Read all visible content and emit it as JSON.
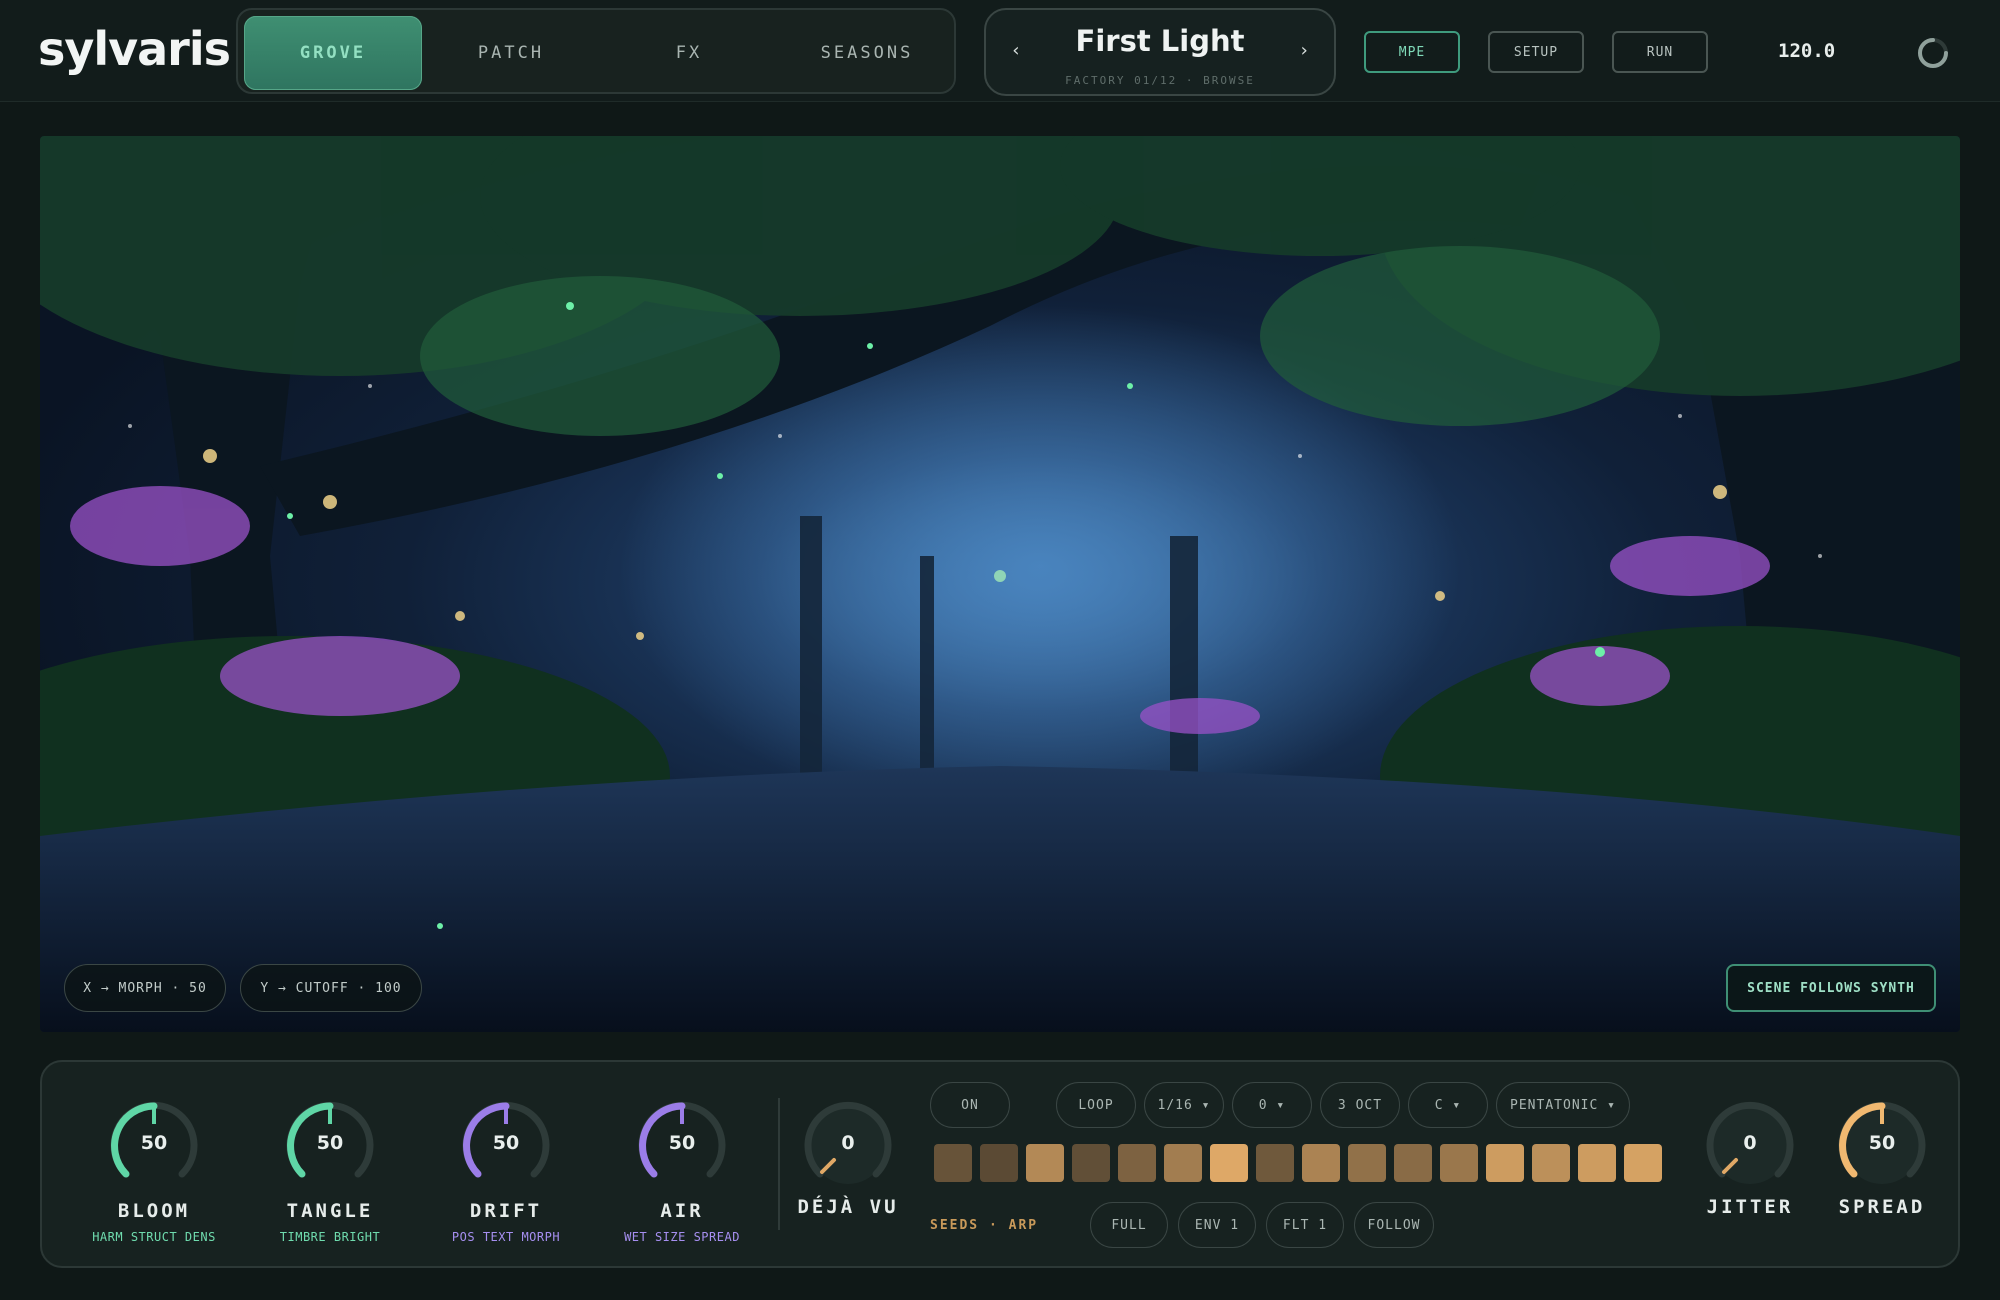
{
  "app": {
    "logo": "sylvaris"
  },
  "tabs": [
    {
      "label": "GROVE",
      "active": true
    },
    {
      "label": "PATCH",
      "active": false
    },
    {
      "label": "FX",
      "active": false
    },
    {
      "label": "SEASONS",
      "active": false
    }
  ],
  "preset": {
    "name": "First Light",
    "subtitle": "FACTORY 01/12 · BROWSE",
    "prev_glyph": "‹",
    "next_glyph": "›"
  },
  "header_buttons": {
    "mpe": "MPE",
    "setup": "SETUP",
    "run": "RUN"
  },
  "bpm": "120.0",
  "scene": {
    "x_chip": "X → MORPH · 50",
    "y_chip": "Y → CUTOFF · 100",
    "follow_button": "SCENE FOLLOWS SYNTH"
  },
  "macros": [
    {
      "label": "BLOOM",
      "sub": "HARM STRUCT DENS",
      "value": "50",
      "color": "#5fd6a6"
    },
    {
      "label": "TANGLE",
      "sub": "TIMBRE BRIGHT",
      "value": "50",
      "color": "#5fd6a6"
    },
    {
      "label": "DRIFT",
      "sub": "POS TEXT MORPH",
      "value": "50",
      "color": "#9b7de8"
    },
    {
      "label": "AIR",
      "sub": "WET SIZE SPREAD",
      "value": "50",
      "color": "#9b7de8"
    }
  ],
  "dejavu": {
    "label": "DÉJÀ VU",
    "value": "0",
    "color": "#e0a866"
  },
  "sequencer": {
    "on": "ON",
    "loop": "LOOP",
    "rate": "1/16 ▾",
    "offset": "0 ▾",
    "octaves": "3 OCT",
    "root": "C ▾",
    "scale": "PENTATONIC ▾",
    "steps": [
      0.25,
      0.18,
      0.7,
      0.22,
      0.38,
      0.6,
      0.95,
      0.3,
      0.65,
      0.5,
      0.45,
      0.55,
      0.85,
      0.75,
      0.85,
      0.9
    ],
    "mode_label": "SEEDS · ARP",
    "full": "FULL",
    "env": "ENV 1",
    "flt": "FLT 1",
    "follow": "FOLLOW"
  },
  "jitter": {
    "label": "JITTER",
    "value": "0",
    "color": "#e0a866"
  },
  "spread": {
    "label": "SPREAD",
    "value": "50",
    "color": "#f0b870"
  },
  "colors": {
    "accent_green": "#5fd6a6",
    "accent_purple": "#9b7de8",
    "accent_amber": "#e0a866",
    "step_color": "#e6ae6a"
  },
  "icons": {
    "spinner": "loading-spinner-icon"
  }
}
